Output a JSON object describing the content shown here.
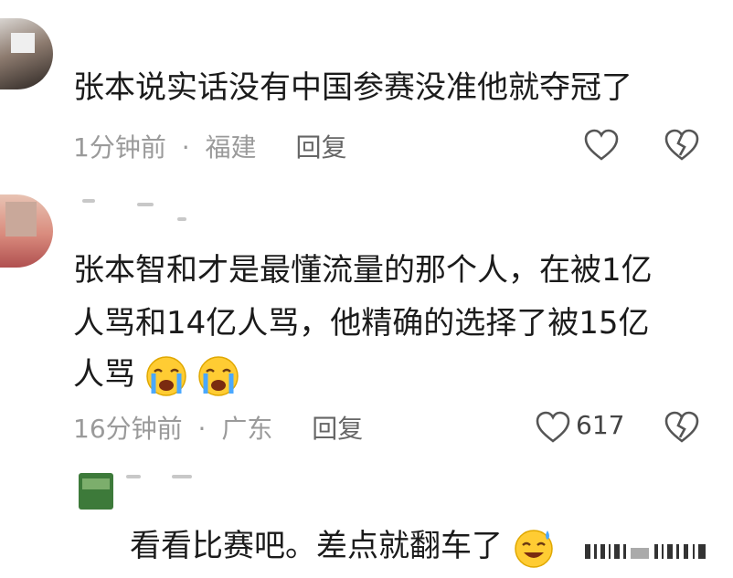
{
  "comments": [
    {
      "text": "张本说实话没有中国参赛没准他就夺冠了",
      "time": "1分钟前",
      "location": "福建",
      "reply_label": "回复"
    },
    {
      "line1": "张本智和才是最懂流量的那个人，在被1亿",
      "line2": "人骂和14亿人骂，他精确的选择了被15亿",
      "line3": "人骂",
      "emoji": [
        "crying-face",
        "crying-face"
      ],
      "time": "16分钟前",
      "location": "广东",
      "reply_label": "回复",
      "like_count": "617"
    },
    {
      "text": "看看比赛吧。差点就翻车了",
      "emoji": "sweat-smile-face"
    }
  ],
  "separator": "·"
}
